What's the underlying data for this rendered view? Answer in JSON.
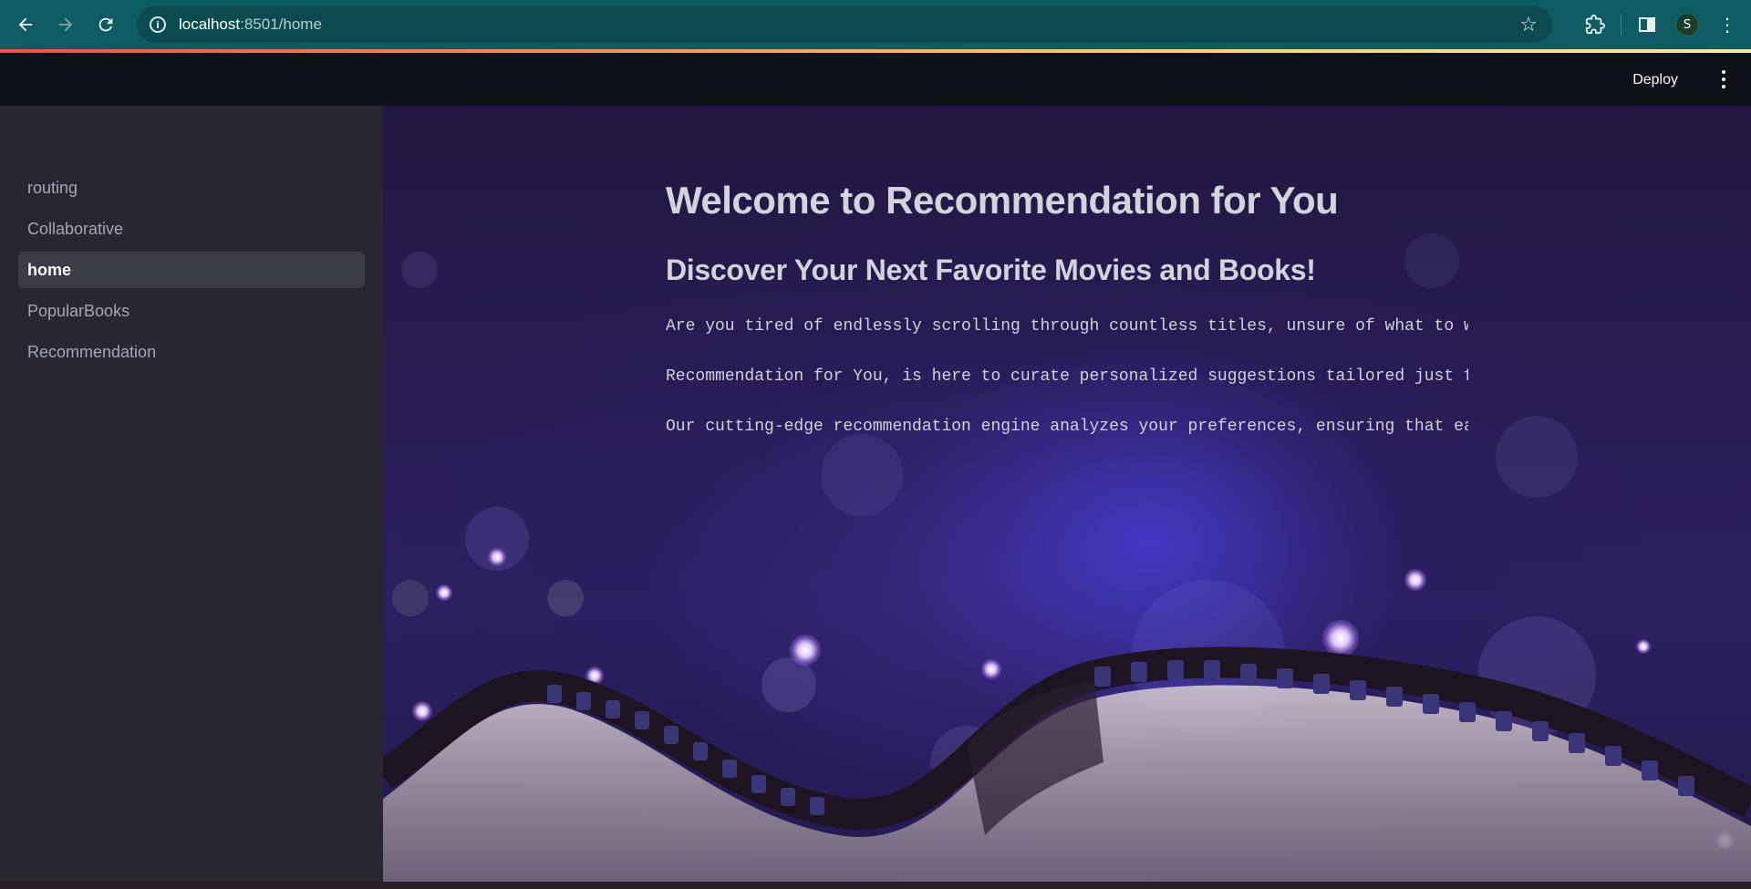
{
  "browser": {
    "url_host": "localhost",
    "url_path": ":8501/home",
    "nav_icons": [
      "back-arrow-icon",
      "forward-arrow-icon",
      "reload-icon"
    ],
    "toolbar_icons": [
      "bookmark-star-icon",
      "extensions-icon",
      "side-panel-icon",
      "profile-avatar",
      "browser-menu-icon"
    ],
    "profile_initial": "S",
    "theme_color": "#0d5c63"
  },
  "header": {
    "deploy_label": "Deploy"
  },
  "sidebar": {
    "items": [
      {
        "label": "routing",
        "active": false
      },
      {
        "label": "Collaborative",
        "active": false
      },
      {
        "label": "home",
        "active": true
      },
      {
        "label": "PopularBooks",
        "active": false
      },
      {
        "label": "Recommendation",
        "active": false
      }
    ]
  },
  "main": {
    "title": "Welcome to Recommendation for You",
    "subtitle": "Discover Your Next Favorite Movies and Books!",
    "paragraphs": [
      "Are you tired of endlessly scrolling through countless titles, unsure of what to wat",
      "Recommendation for You, is here to curate personalized suggestions tailored just for",
      "Our cutting-edge recommendation engine analyzes your preferences, ensuring that each"
    ]
  },
  "colors": {
    "app_background": "#0e1117",
    "sidebar_background": "#262730",
    "sidebar_active": "#3a3c48",
    "accent_gradient": [
      "#ff4b4b",
      "#ffd36e"
    ]
  }
}
